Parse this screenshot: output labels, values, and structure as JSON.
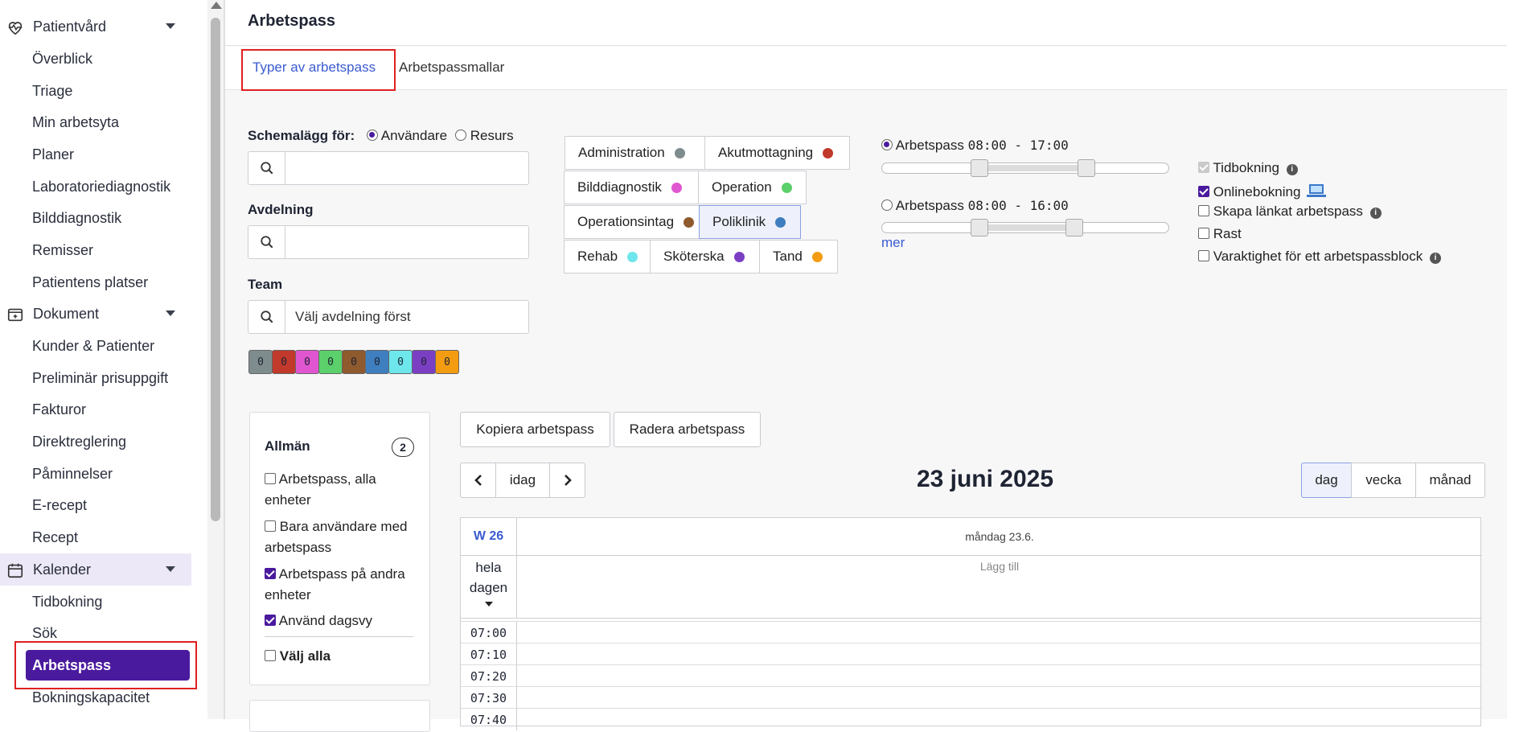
{
  "sidebar": {
    "sections": [
      {
        "label": "Patientvård",
        "icon": "heart-pulse-icon"
      },
      {
        "label": "Dokument",
        "icon": "document-folder-icon"
      },
      {
        "label": "Kalender",
        "icon": "calendar-icon"
      }
    ],
    "patientvard_items": [
      "Överblick",
      "Triage",
      "Min arbetsyta",
      "Planer",
      "Laboratoriediagnostik",
      "Bilddiagnostik",
      "Remisser",
      "Patientens platser"
    ],
    "dokument_items": [
      "Kunder & Patienter",
      "Preliminär prisuppgift",
      "Fakturor",
      "Direktreglering",
      "Påminnelser",
      "E-recept",
      "Recept"
    ],
    "kalender_items": [
      "Tidbokning",
      "Sök",
      "Arbetspass",
      "Bokningskapacitet"
    ],
    "active_item": "Arbetspass",
    "active_color": "#4a1a9e"
  },
  "header": {
    "title": "Arbetspass"
  },
  "tabs": [
    {
      "label": "Typer av arbetspass",
      "active": true
    },
    {
      "label": "Arbetspassmallar",
      "active": false
    }
  ],
  "filters": {
    "schedule_for_label": "Schemalägg för:",
    "schedule_options": [
      {
        "label": "Användare",
        "selected": true
      },
      {
        "label": "Resurs",
        "selected": false
      }
    ],
    "search_value": "",
    "department_label": "Avdelning",
    "department_value": "",
    "team_label": "Team",
    "team_value": "Välj avdelning först"
  },
  "color_counters": [
    {
      "color": "#7f8c8d",
      "count": "0"
    },
    {
      "color": "#c0392b",
      "count": "0"
    },
    {
      "color": "#e056d0",
      "count": "0"
    },
    {
      "color": "#5cd06b",
      "count": "0"
    },
    {
      "color": "#8e5a2e",
      "count": "0"
    },
    {
      "color": "#3f7fbf",
      "count": "0"
    },
    {
      "color": "#6de6ec",
      "count": "0"
    },
    {
      "color": "#7b3fc4",
      "count": "0"
    },
    {
      "color": "#f39c12",
      "count": "0"
    }
  ],
  "shift_types": [
    {
      "label": "Administration",
      "color": "#7f8c8d",
      "selected": false
    },
    {
      "label": "Akutmottagning",
      "color": "#c0392b",
      "selected": false
    },
    {
      "label": "Bilddiagnostik",
      "color": "#e056d0",
      "selected": false
    },
    {
      "label": "Operation",
      "color": "#5cd06b",
      "selected": false
    },
    {
      "label": "Operationsintag",
      "color": "#8e5a2e",
      "selected": false
    },
    {
      "label": "Poliklinik",
      "color": "#3f7fbf",
      "selected": true
    },
    {
      "label": "Rehab",
      "color": "#6de6ec",
      "selected": false
    },
    {
      "label": "Sköterska",
      "color": "#7b3fc4",
      "selected": false
    },
    {
      "label": "Tand",
      "color": "#f39c12",
      "selected": false
    }
  ],
  "shift_times": [
    {
      "label": "Arbetspass",
      "time": "08:00 - 17:00",
      "selected": true
    },
    {
      "label": "Arbetspass",
      "time": "08:00 - 16:00",
      "selected": false
    }
  ],
  "more_link": "mer",
  "options": [
    {
      "label": "Tidbokning",
      "checked": true,
      "disabled": true,
      "info": true
    },
    {
      "label": "Onlinebokning",
      "checked": true,
      "disabled": false,
      "info": false
    },
    {
      "label": "Skapa länkat arbetspass",
      "checked": false,
      "disabled": false,
      "info": true
    },
    {
      "label": "Rast",
      "checked": false,
      "disabled": false,
      "info": false
    },
    {
      "label": "Varaktighet för ett arbetspassblock",
      "checked": false,
      "disabled": false,
      "info": true
    }
  ],
  "general_panel": {
    "title": "Allmän",
    "badge": "2",
    "options": [
      {
        "label": "Arbetspass, alla enheter",
        "checked": false
      },
      {
        "label": "Bara användare med arbetspass",
        "checked": false
      },
      {
        "label": "Arbetspass på andra enheter",
        "checked": true
      },
      {
        "label": "Använd dagsvy",
        "checked": true
      }
    ],
    "select_all": "Välj alla"
  },
  "actions": {
    "copy": "Kopiera arbetspass",
    "delete": "Radera arbetspass"
  },
  "calendar": {
    "today": "idag",
    "date_title": "23 juni 2025",
    "views": [
      {
        "label": "dag",
        "active": true
      },
      {
        "label": "vecka",
        "active": false
      },
      {
        "label": "månad",
        "active": false
      }
    ],
    "week": "W 26",
    "day_header": "måndag 23.6.",
    "allday": "hela dagen",
    "add": "Lägg till",
    "times": [
      "07:00",
      "07:10",
      "07:20",
      "07:30",
      "07:40"
    ]
  }
}
